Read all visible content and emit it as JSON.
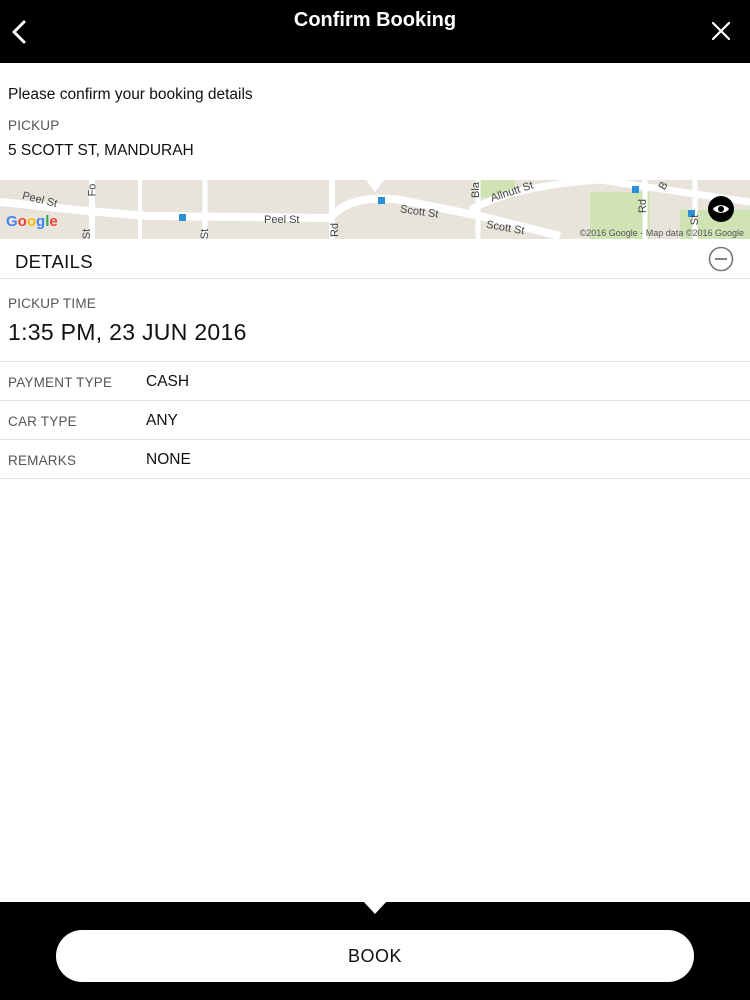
{
  "header": {
    "title": "Confirm Booking",
    "back_icon": "chevron-left-icon",
    "close_icon": "close-icon"
  },
  "intro_text": "Please confirm your booking details",
  "pickup": {
    "label": "PICKUP",
    "address": "5 SCOTT ST, MANDURAH"
  },
  "map": {
    "brand": "Google",
    "copyright": "©2016 Google - Map data ©2016 Google",
    "streets": [
      "Peel St",
      "Peel St",
      "Scott St",
      "Scott St",
      "Allnutt St",
      "Rd",
      "St",
      "St",
      "Fo",
      "Bla",
      "Rd",
      "St",
      "B"
    ],
    "view_icon": "eye-icon"
  },
  "details": {
    "title": "DETAILS",
    "collapse_icon": "minus-circle-icon",
    "pickup_time_label": "PICKUP TIME",
    "pickup_time_value": "1:35 PM, 23 JUN 2016",
    "rows": [
      {
        "label": "PAYMENT TYPE",
        "value": "CASH"
      },
      {
        "label": "CAR TYPE",
        "value": "ANY"
      },
      {
        "label": "REMARKS",
        "value": "NONE"
      }
    ]
  },
  "book_button": {
    "label": "BOOK"
  },
  "colors": {
    "bar": "#000000",
    "background": "#ffffff",
    "divider": "#e3e3e3",
    "map_land": "#e8e4dc",
    "map_green": "#cfe3b4"
  }
}
